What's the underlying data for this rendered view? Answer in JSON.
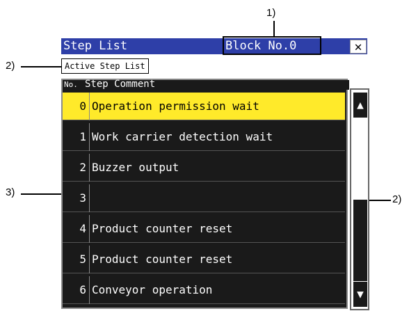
{
  "window": {
    "title": "Step List",
    "block_label": "Block No.0",
    "close_glyph": "✕"
  },
  "active_label": "Active Step List",
  "table": {
    "header_no": "No.",
    "header_comment": "Step Comment",
    "rows": [
      {
        "no": "0",
        "comment": "Operation permission wait",
        "selected": true
      },
      {
        "no": "1",
        "comment": "Work carrier detection wait"
      },
      {
        "no": "2",
        "comment": "Buzzer output"
      },
      {
        "no": "3",
        "comment": ""
      },
      {
        "no": "4",
        "comment": "Product counter reset"
      },
      {
        "no": "5",
        "comment": "Product counter reset"
      },
      {
        "no": "6",
        "comment": "Conveyor operation"
      }
    ]
  },
  "scrollbar": {
    "up_glyph": "▲",
    "down_glyph": "▼"
  },
  "callouts": {
    "c1": "1)",
    "c2_left": "2)",
    "c3": "3)",
    "c2_right": "2)"
  },
  "colors": {
    "titlebar": "#2e3fa8",
    "selected_row": "#ffea2a",
    "table_bg": "#1a1a1a"
  }
}
